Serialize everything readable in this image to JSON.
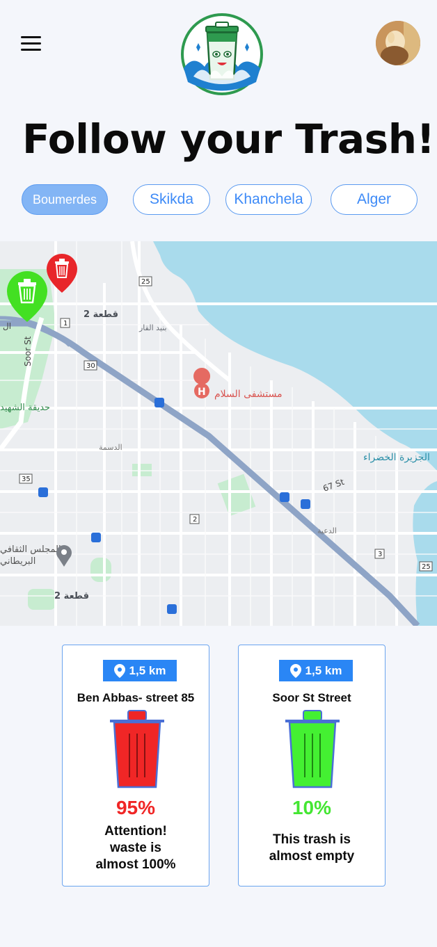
{
  "header": {
    "menu_icon": "hamburger-menu-icon",
    "logo_icon": "smiling-trash-can-logo",
    "avatar_icon": "user-avatar-photo"
  },
  "title": "Follow your Trash!",
  "cities": [
    {
      "label": "Boumerdes",
      "active": true
    },
    {
      "label": "Skikda",
      "active": false
    },
    {
      "label": "Khanchela",
      "active": false
    },
    {
      "label": "Alger",
      "active": false
    }
  ],
  "map": {
    "labels": {
      "qitaa2_top": "قطعة 2",
      "bnid": "بنيد القار",
      "soor": "Soor St",
      "hadiqa": "حديقة الشهيد",
      "hospital": "مستشفى السلام",
      "dasma": "الدسمة",
      "green_island": "الجزيرة الخضراء",
      "st67": "67 St",
      "daiya": "الدعية",
      "british": "المجلس الثقافي البريطاني",
      "qitaa2_bottom": "قطعة 2",
      "partial": "ال"
    },
    "road_shields": [
      "25",
      "1",
      "30",
      "35",
      "2",
      "3",
      "25"
    ],
    "pins": [
      {
        "color": "#e8262a",
        "icon": "trash-pin-icon"
      },
      {
        "color": "#43e022",
        "icon": "trash-pin-icon"
      }
    ]
  },
  "cards": [
    {
      "distance": "1,5 km",
      "location": "Ben Abbas- street 85",
      "percent": "95%",
      "color": "#f02626",
      "message": [
        "Attention!",
        "waste is",
        "almost 100%"
      ]
    },
    {
      "distance": "1,5 km",
      "location": "Soor St Street",
      "percent": "10%",
      "color": "#44f032",
      "message": [
        "This trash is",
        "almost empty"
      ]
    }
  ]
}
